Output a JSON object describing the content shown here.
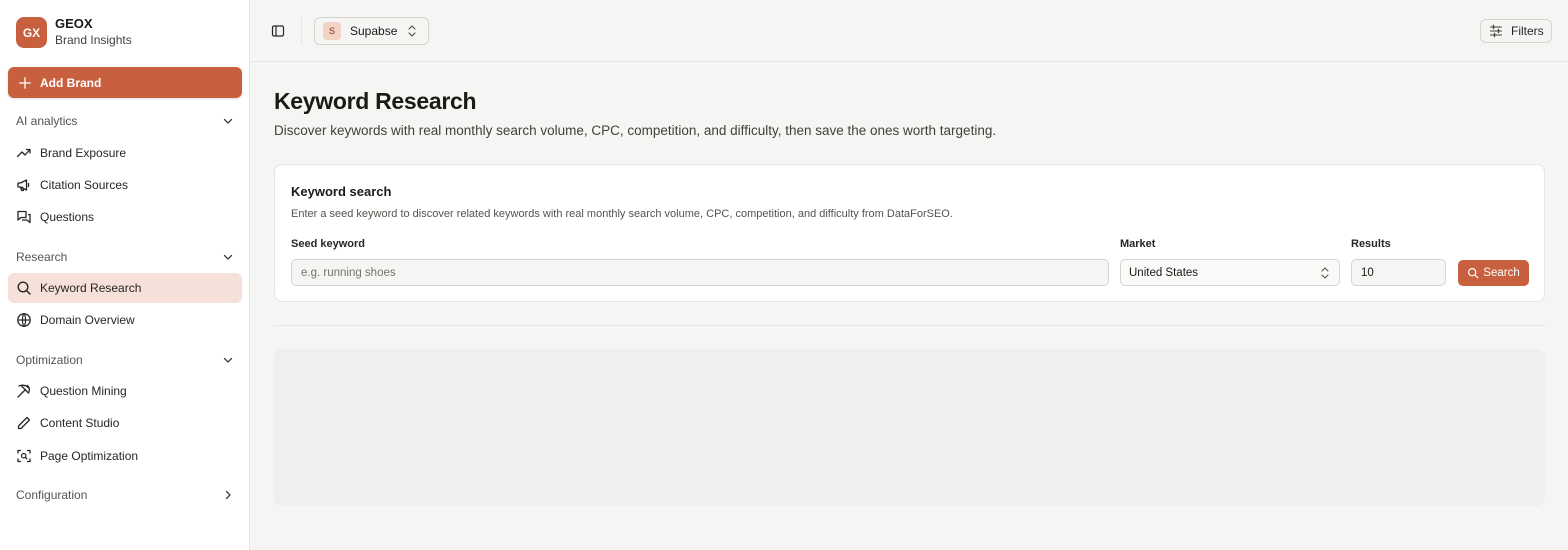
{
  "brand": {
    "logo_text": "GX",
    "name": "GEOX",
    "subtitle": "Brand Insights"
  },
  "sidebar": {
    "add_button": "Add Brand",
    "sections": [
      {
        "label": "AI analytics",
        "expanded": true,
        "items": [
          {
            "label": "Brand Exposure",
            "icon": "trending-up-icon"
          },
          {
            "label": "Citation Sources",
            "icon": "megaphone-icon"
          },
          {
            "label": "Questions",
            "icon": "message-square-icon"
          }
        ]
      },
      {
        "label": "Research",
        "expanded": true,
        "items": [
          {
            "label": "Keyword Research",
            "icon": "search-icon",
            "active": true
          },
          {
            "label": "Domain Overview",
            "icon": "globe-icon"
          }
        ]
      },
      {
        "label": "Optimization",
        "expanded": true,
        "items": [
          {
            "label": "Question Mining",
            "icon": "pickaxe-icon"
          },
          {
            "label": "Content Studio",
            "icon": "pen-icon"
          },
          {
            "label": "Page Optimization",
            "icon": "scan-icon"
          }
        ]
      },
      {
        "label": "Configuration",
        "expanded": false,
        "items": []
      }
    ]
  },
  "topbar": {
    "project": {
      "avatar": "S",
      "name": "Supabse"
    },
    "filters_label": "Filters"
  },
  "page": {
    "title": "Keyword Research",
    "description": "Discover keywords with real monthly search volume, CPC, competition, and difficulty, then save the ones worth targeting."
  },
  "search_card": {
    "title": "Keyword search",
    "description": "Enter a seed keyword to discover related keywords with real monthly search volume, CPC, competition, and difficulty from DataForSEO.",
    "seed_label": "Seed keyword",
    "seed_placeholder": "e.g. running shoes",
    "seed_value": "",
    "market_label": "Market",
    "market_value": "United States",
    "results_label": "Results",
    "results_value": "10",
    "search_button": "Search"
  },
  "colors": {
    "accent": "#c8603f",
    "active_bg": "#f5e1da"
  }
}
